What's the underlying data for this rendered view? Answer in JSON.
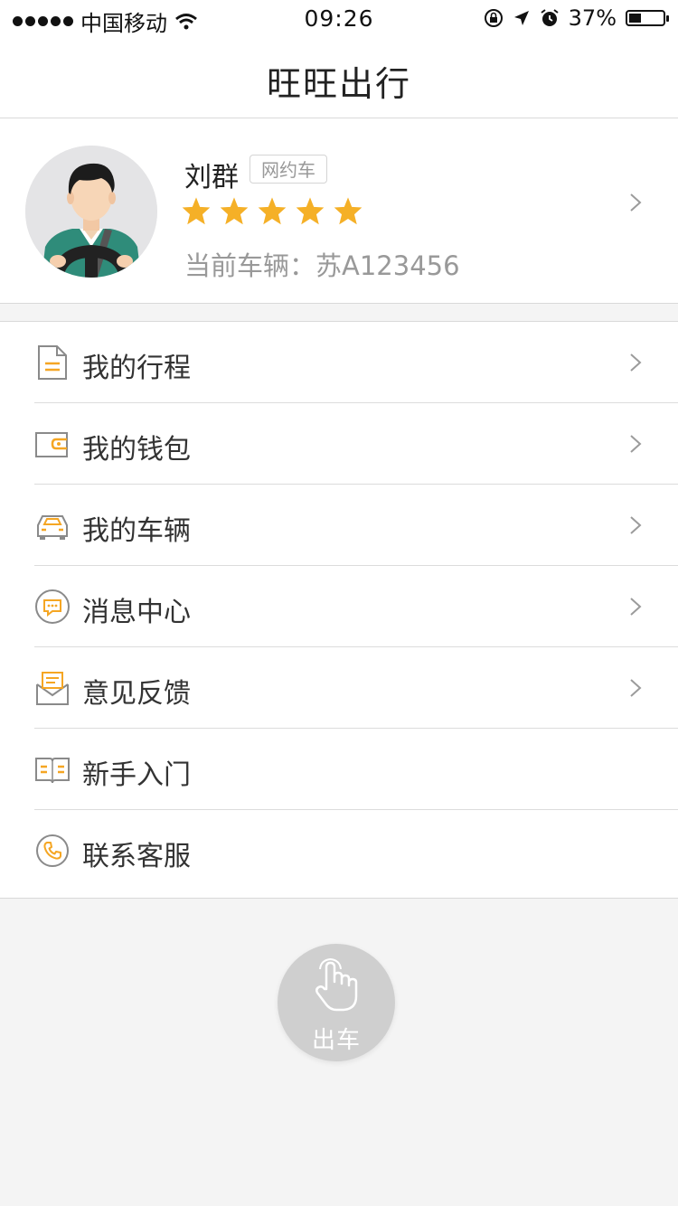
{
  "status_bar": {
    "carrier": "中国移动",
    "time": "09:26",
    "battery_percent": "37%",
    "battery_level": 0.37,
    "icons": [
      "signal-dots-icon",
      "wifi-icon",
      "orientation-lock-icon",
      "location-arrow-icon",
      "alarm-icon",
      "battery-icon"
    ]
  },
  "header": {
    "title": "旺旺出行"
  },
  "profile": {
    "name": "刘群",
    "badge": "网约车",
    "rating": 5,
    "rating_max": 5,
    "vehicle_label": "当前车辆：",
    "vehicle_plate": "苏A123456"
  },
  "menu": {
    "items": [
      {
        "label": "我的行程",
        "icon": "document-icon",
        "has_chevron": true
      },
      {
        "label": "我的钱包",
        "icon": "wallet-icon",
        "has_chevron": true
      },
      {
        "label": "我的车辆",
        "icon": "car-icon",
        "has_chevron": true
      },
      {
        "label": "消息中心",
        "icon": "message-icon",
        "has_chevron": true
      },
      {
        "label": "意见反馈",
        "icon": "feedback-envelope-icon",
        "has_chevron": true
      },
      {
        "label": "新手入门",
        "icon": "guide-book-icon",
        "has_chevron": false
      },
      {
        "label": "联系客服",
        "icon": "phone-icon",
        "has_chevron": false
      }
    ]
  },
  "start_button": {
    "label": "出车",
    "icon": "hand-tap-icon"
  },
  "colors": {
    "accent": "#f5a623",
    "star": "#f5b027",
    "text_secondary": "#999999",
    "background": "#f4f4f4"
  }
}
